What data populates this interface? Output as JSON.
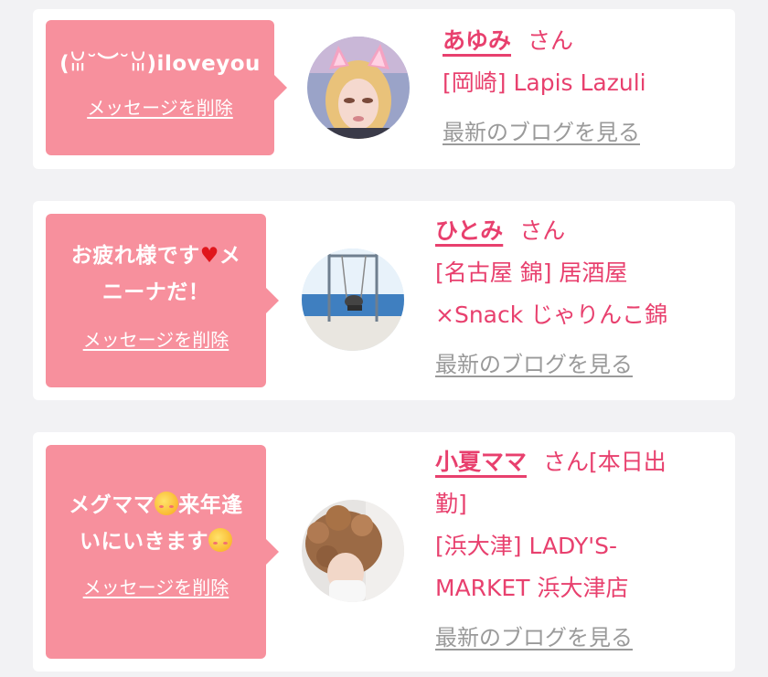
{
  "cards": [
    {
      "message": "(ꈍ˘︶˘ꈍ)iloveyou",
      "delete_label": "メッセージを削除",
      "name": "あゆみ",
      "suffix": "さん",
      "store": "[岡崎] Lapis Lazuli",
      "blog_link": "最新のブログを見る",
      "avatar_icon": "cat-ear-girl-avatar"
    },
    {
      "message_line1": "お疲れ様です",
      "message_heart": "♥",
      "message_line1_end": "メ",
      "message_line2": "ニーナだ！",
      "delete_label": "メッセージを削除",
      "name": "ひとみ",
      "suffix": "さん",
      "store_line1": "[名古屋 錦] 居酒屋",
      "store_line2": "×Snack じゃりんこ錦",
      "blog_link": "最新のブログを見る",
      "avatar_icon": "beach-swing-avatar"
    },
    {
      "message_line1a": "メグママ",
      "message_line1b": "来年逢",
      "message_line2": "いにいきます",
      "delete_label": "メッセージを削除",
      "name": "小夏ママ",
      "suffix": "さん[本日出",
      "suffix_line2": "勤]",
      "store_line1": "[浜大津] LADY'S-",
      "store_line2": "MARKET 浜大津店",
      "blog_link": "最新のブログを見る",
      "avatar_icon": "curly-hair-avatar"
    }
  ],
  "colors": {
    "bubble": "#f7909d",
    "accent": "#e8406e",
    "muted": "#9a9a9a",
    "background": "#f2f2f4"
  }
}
